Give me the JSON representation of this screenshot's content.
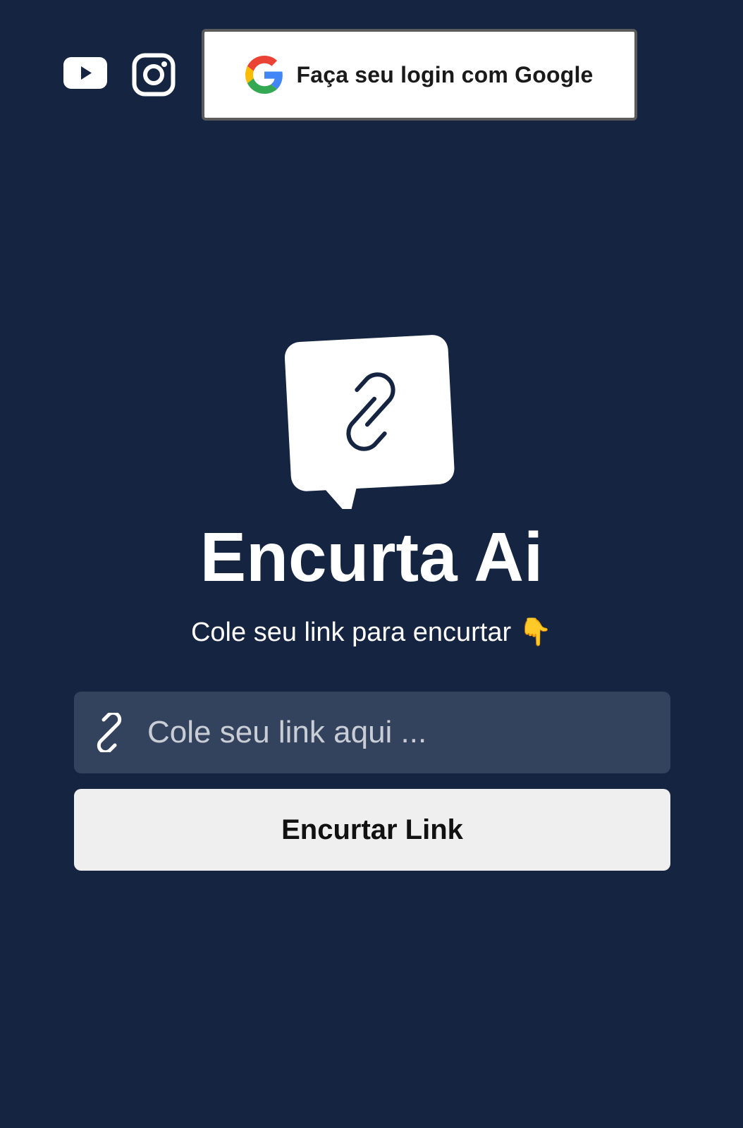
{
  "header": {
    "social_links": [
      {
        "name": "youtube-icon"
      },
      {
        "name": "instagram-icon"
      }
    ],
    "google_login": {
      "icon": "google-logo-icon",
      "label": "Faça seu login com Google"
    }
  },
  "hero": {
    "logo_icon": "chain-link-chat-bubble-icon",
    "title": "Encurta Ai",
    "subtitle": "Cole seu link para encurtar",
    "subtitle_emoji": "👇"
  },
  "form": {
    "input_icon": "link-icon",
    "input_placeholder": "Cole seu link aqui ...",
    "input_value": "",
    "submit_label": "Encurtar Link"
  },
  "colors": {
    "background": "#142441",
    "input_background": "#34435d",
    "button_background": "#efefef",
    "text_primary": "#ffffff"
  }
}
